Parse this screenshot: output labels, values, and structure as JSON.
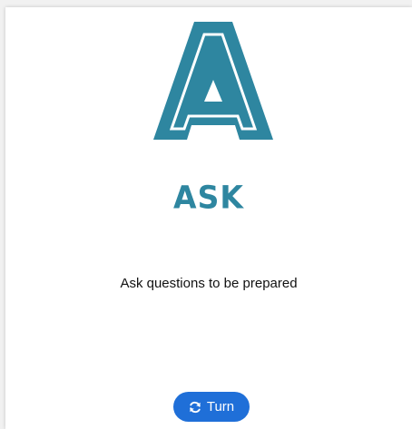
{
  "card": {
    "logo_letter": "A",
    "word": "ASK",
    "description": "Ask questions to be prepared",
    "accent_color": "#2e86a0"
  },
  "actions": {
    "turn_label": "Turn",
    "turn_icon": "refresh-icon",
    "button_color": "#1f6fd8"
  }
}
